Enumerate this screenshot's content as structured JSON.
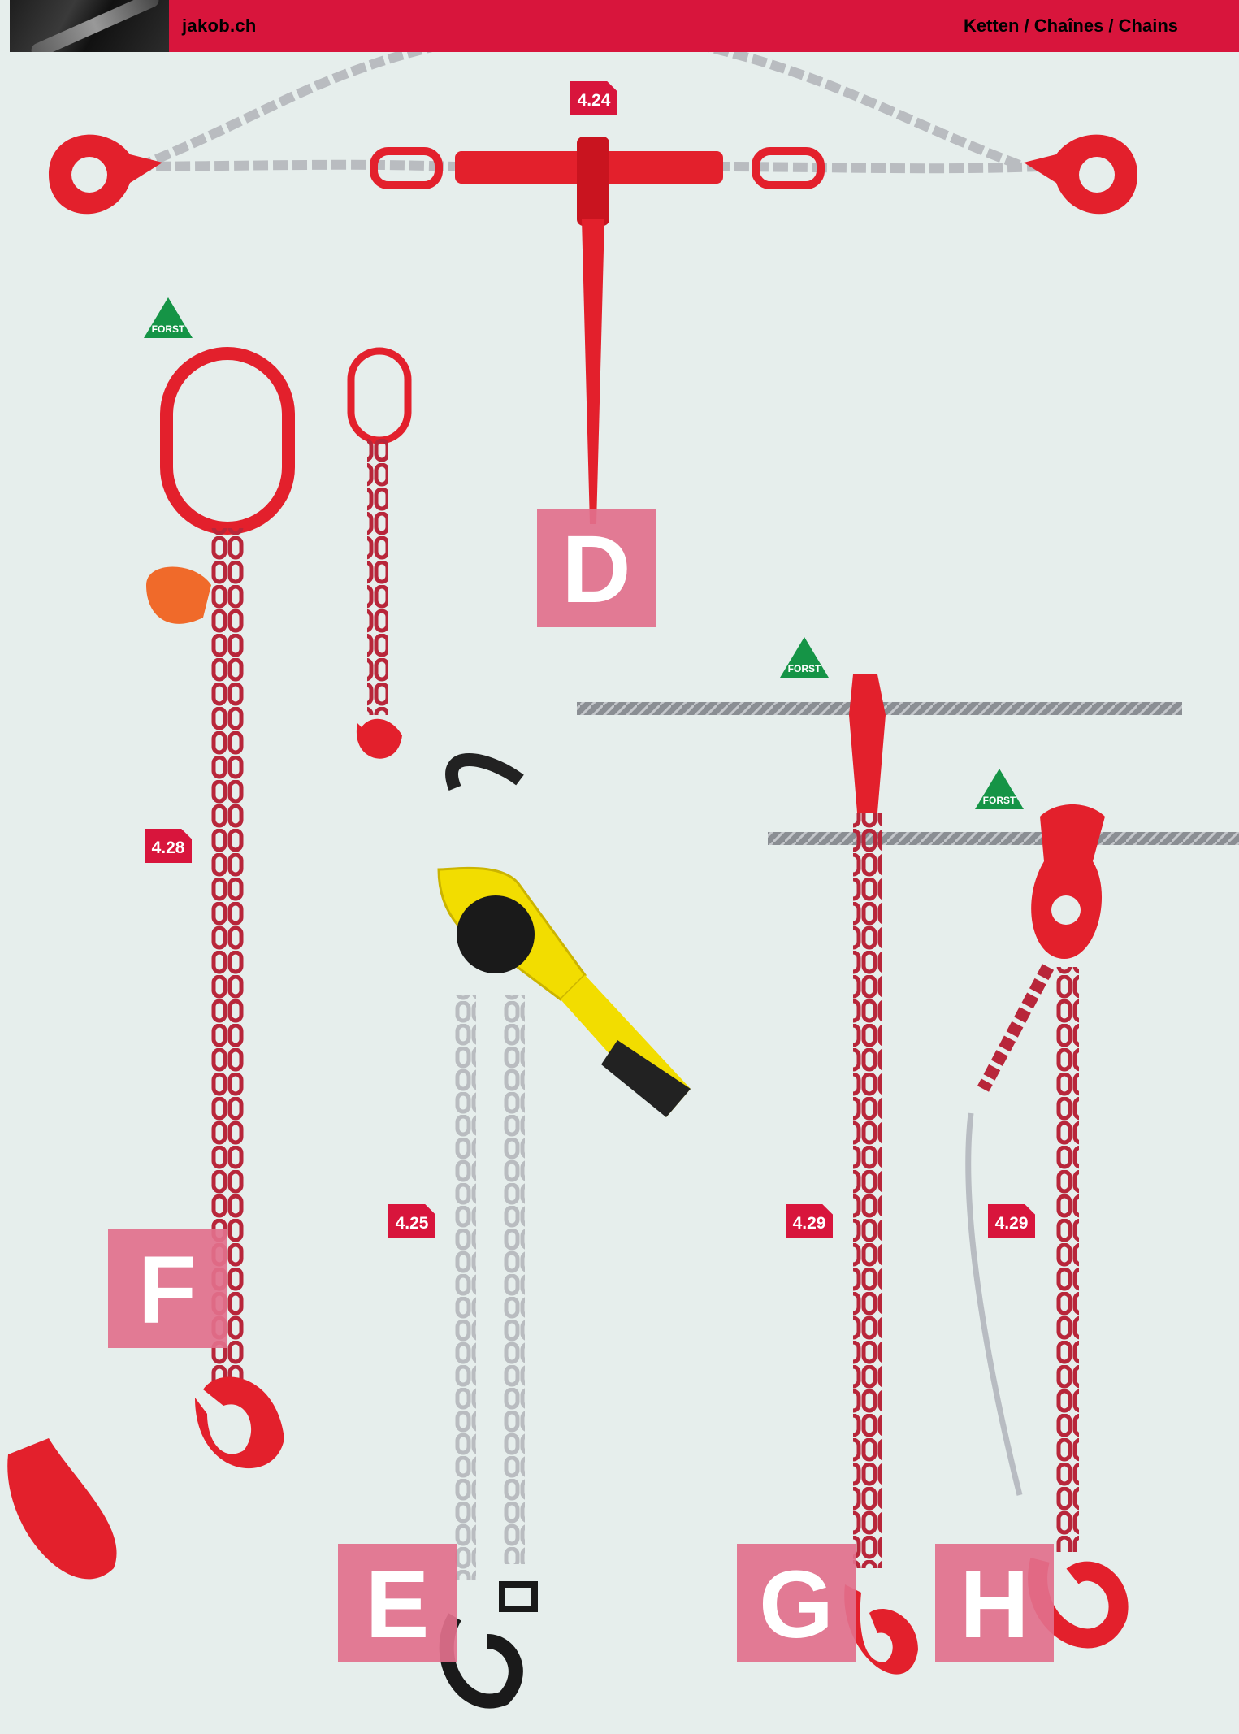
{
  "header": {
    "site": "jakob.ch",
    "section": "Ketten / Chaînes / Chains"
  },
  "tags": [
    "4.24",
    "4.28",
    "4.25",
    "4.29",
    "4.29"
  ],
  "letters": [
    "D",
    "E",
    "F",
    "G",
    "H"
  ],
  "badges": [
    "FORST",
    "FORST",
    "FORST"
  ],
  "colors": {
    "brand_red": "#d8153c",
    "letter_box": "#e2708c",
    "forst_green": "#159446",
    "background": "#e6eeec"
  }
}
